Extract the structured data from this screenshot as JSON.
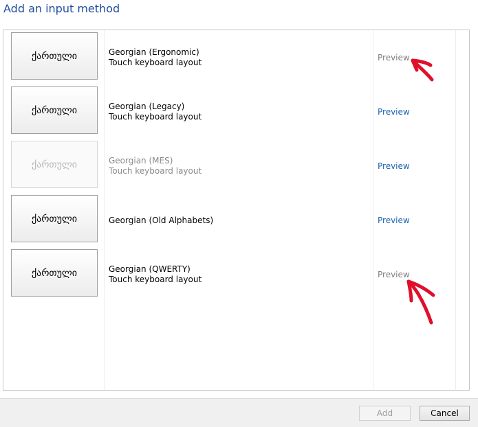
{
  "dialog": {
    "title": "Add an input method"
  },
  "layouts": [
    {
      "tile": "ქართული",
      "name": "Georgian (Ergonomic)",
      "sub": "Touch keyboard layout",
      "preview": "Preview",
      "tile_disabled": false,
      "preview_disabled": true
    },
    {
      "tile": "ქართული",
      "name": "Georgian (Legacy)",
      "sub": "Touch keyboard layout",
      "preview": "Preview",
      "tile_disabled": false,
      "preview_disabled": false
    },
    {
      "tile": "ქართული",
      "name": "Georgian (MES)",
      "sub": "Touch keyboard layout",
      "preview": "Preview",
      "tile_disabled": true,
      "preview_disabled": false
    },
    {
      "tile": "ქართული",
      "name": "Georgian (Old Alphabets)",
      "sub": "",
      "preview": "Preview",
      "tile_disabled": false,
      "preview_disabled": false
    },
    {
      "tile": "ქართული",
      "name": "Georgian (QWERTY)",
      "sub": "Touch keyboard layout",
      "preview": "Preview",
      "tile_disabled": false,
      "preview_disabled": true
    }
  ],
  "footer": {
    "add_label": "Add",
    "cancel_label": "Cancel"
  },
  "colors": {
    "title": "#1f4e9c",
    "link": "#1d64b3",
    "annotation": "#e0102a"
  },
  "annotations": [
    "arrow-pointing-preview-ergonomic",
    "arrow-pointing-preview-qwerty"
  ]
}
